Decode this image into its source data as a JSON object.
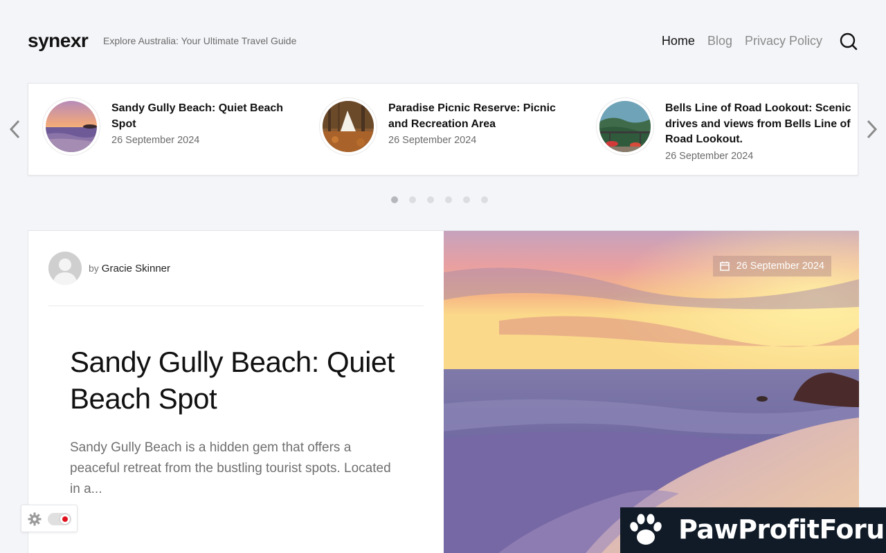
{
  "site": {
    "brand": "synexr",
    "tagline": "Explore Australia: Your Ultimate Travel Guide"
  },
  "nav": {
    "items": [
      {
        "label": "Home",
        "active": true
      },
      {
        "label": "Blog",
        "active": false
      },
      {
        "label": "Privacy Policy",
        "active": false
      }
    ],
    "search_icon": "search-icon"
  },
  "slider": {
    "slides": [
      {
        "title": "Sandy Gully Beach: Quiet Beach Spot",
        "date": "26 September 2024"
      },
      {
        "title": "Paradise Picnic Reserve: Picnic and Recreation Area",
        "date": "26 September 2024"
      },
      {
        "title": "Bells Line of Road Lookout: Scenic drives and views from Bells Line of Road Lookout.",
        "date": "26 September 2024"
      }
    ],
    "dot_count": 6,
    "active_dot": 0
  },
  "featured": {
    "author_prefix": "by",
    "author": "Gracie Skinner",
    "title": "Sandy Gully Beach: Quiet Beach Spot",
    "excerpt": "Sandy Gully Beach is a hidden gem that offers a peaceful retreat from the bustling tourist spots. Located in a...",
    "date": "26 September 2024"
  },
  "watermark": {
    "text": "PawProfitForum"
  },
  "colors": {
    "background": "#f4f5f9",
    "toggle_dot": "#e0131c",
    "watermark_bg": "#101b27"
  }
}
